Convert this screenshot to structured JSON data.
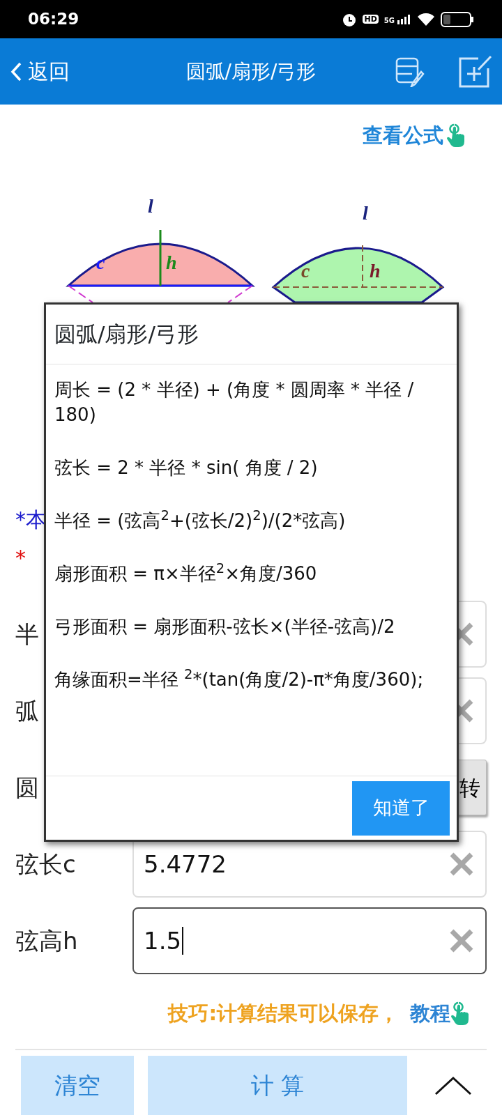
{
  "status_bar": {
    "time": "06:29",
    "badges": [
      "HD",
      "5G"
    ]
  },
  "app_bar": {
    "back": "返回",
    "title": "圆弧/扇形/弓形"
  },
  "formula_link": "查看公式",
  "diagram": {
    "labels": [
      {
        "text": "l",
        "color": "#1a237e"
      },
      {
        "text": "l",
        "color": "#1a237e"
      },
      {
        "text": "c",
        "color": "#1a1aff"
      },
      {
        "text": "h",
        "color": "#1b8a1b"
      },
      {
        "text": "c",
        "color": "#7a4a2a"
      },
      {
        "text": "h",
        "color": "#7a1a2a"
      }
    ]
  },
  "notes": [
    {
      "text": "*本",
      "color": "#1a1acc"
    },
    {
      "text": "*",
      "color": "#e01010"
    }
  ],
  "rows": [
    {
      "kind": "field",
      "label": "半"
    },
    {
      "kind": "field",
      "label": "弧"
    },
    {
      "kind": "button",
      "label": "圆",
      "button": "转"
    },
    {
      "kind": "field",
      "label": "弦长c",
      "value": "5.4772",
      "focused": false
    },
    {
      "kind": "field",
      "label": "弦高h",
      "value": "1.5",
      "focused": true
    }
  ],
  "tip": {
    "text": "技巧:计算结果可以保存，",
    "link": "教程"
  },
  "bottom": {
    "clear": "清空",
    "calculate": "计 算"
  },
  "dialog": {
    "title": "圆弧/扇形/弓形",
    "formulas": [
      "周长 = (2 * 半径) + (角度 * 圆周率 * 半径 / 180)",
      "弦长 = 2 * 半径 * sin( 角度  / 2)",
      "半径 = (弦高$^{2}$+(弦长/2)$^{2}$)/(2*弦高)",
      "扇形面积 = π×半径$^{2}$×角度/360",
      "弓形面积 = 扇形面积-弦长×(半径-弦高)/2",
      "角缘面积=半径 $^{2}$*(tan(角度/2)-π*角度/360);"
    ],
    "button": "知道了"
  }
}
